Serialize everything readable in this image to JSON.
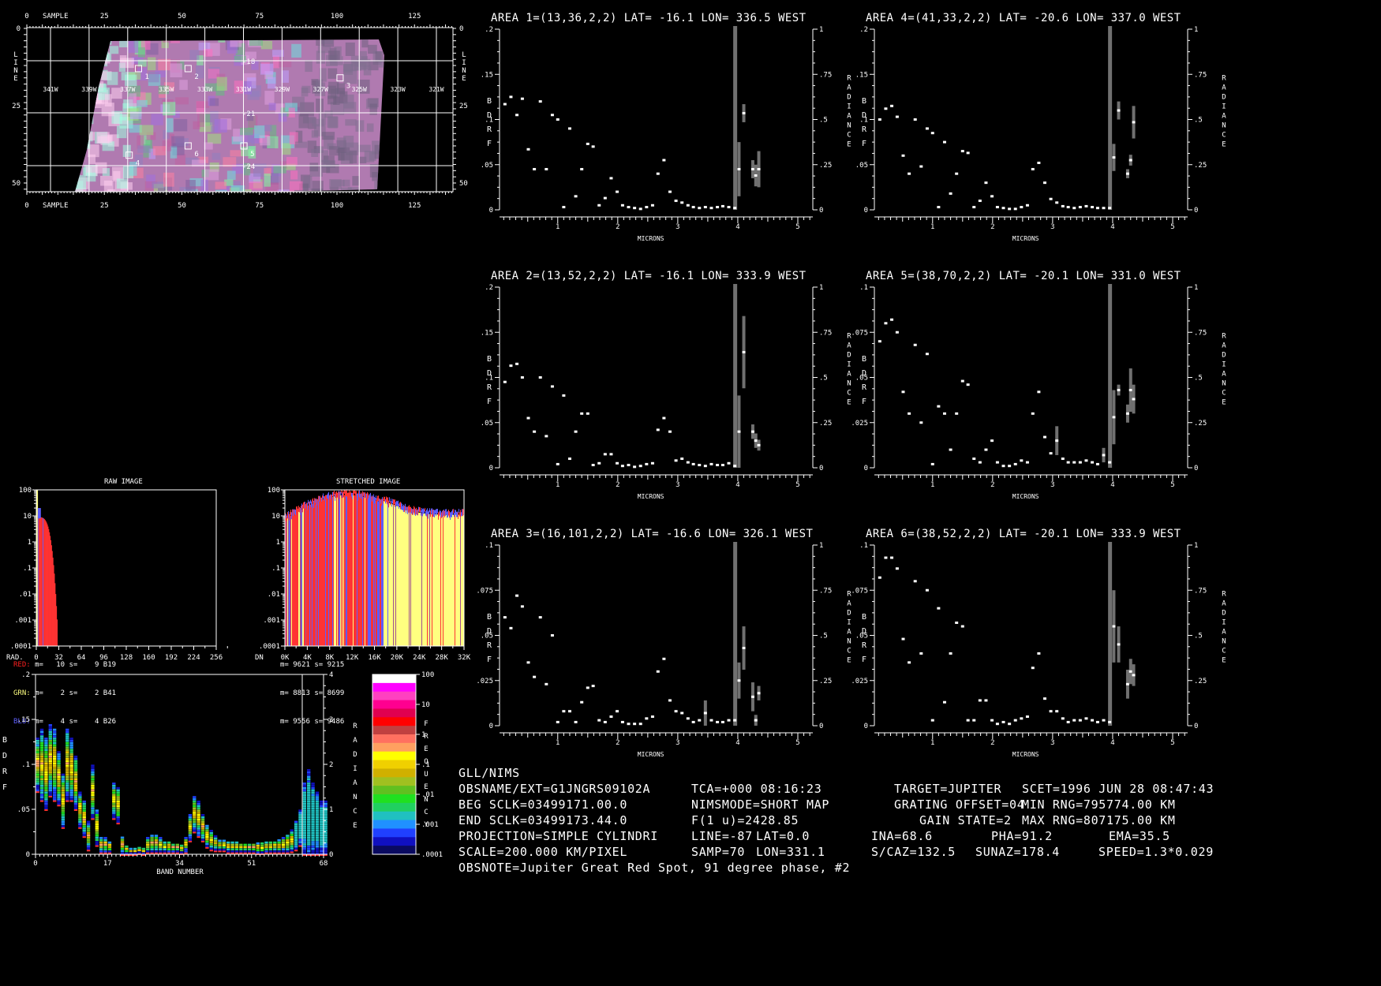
{
  "map": {
    "sample_label": "SAMPLE",
    "line_label": "LINE",
    "sample_ticks": [
      "0",
      "25",
      "50",
      "75",
      "100",
      "125"
    ],
    "line_ticks": [
      "0",
      "25",
      "50"
    ],
    "lon_labels": [
      "341W",
      "339W",
      "337W",
      "335W",
      "333W",
      "331W",
      "329W",
      "327W",
      "325W",
      "323W",
      "321W"
    ],
    "lat_labels": [
      "-18",
      "-21",
      "-24"
    ],
    "areas": [
      {
        "id": "1",
        "line": 13,
        "sample": 36
      },
      {
        "id": "2",
        "line": 13,
        "sample": 52
      },
      {
        "id": "3",
        "line": 16,
        "sample": 101
      },
      {
        "id": "4",
        "line": 41,
        "sample": 33
      },
      {
        "id": "5",
        "line": 38,
        "sample": 70
      },
      {
        "id": "6",
        "line": 38,
        "sample": 52
      }
    ]
  },
  "raw_hist": {
    "title": "RAW IMAGE",
    "x_label": "RAD.",
    "x_ticks": [
      "0",
      "32",
      "64",
      "96",
      "128",
      "160",
      "192",
      "224",
      "256"
    ],
    "y_ticks": [
      "100",
      "10",
      "1",
      ".1",
      ".01",
      ".001",
      ".0001"
    ],
    "stats": [
      {
        "label": "RED:",
        "text": "m=   10 s=    9 B19",
        "color": "#ff2020"
      },
      {
        "label": "GRN:",
        "text": "m=    2 s=    2 B41",
        "color": "#ffff80"
      },
      {
        "label": "BLU:",
        "text": "m=    4 s=    4 B26",
        "color": "#6060ff"
      }
    ]
  },
  "stretched_hist": {
    "title": "STRETCHED IMAGE",
    "x_label": "DN",
    "x_ticks": [
      "0K",
      "4K",
      "8K",
      "12K",
      "16K",
      "20K",
      "24K",
      "28K",
      "32K"
    ],
    "y_ticks": [
      "100",
      "10",
      "1",
      ".1",
      ".01",
      ".001",
      ".0001"
    ],
    "stats": [
      "m= 9621 s= 9215",
      "m= 8813 s= 8699",
      "m= 9556 s= 9486"
    ]
  },
  "colors": {
    "red": "#ff3333",
    "yellow": "#ffff80",
    "blue": "#5c5cff",
    "bar": "#707070"
  },
  "band_plot": {
    "x_label": "BAND NUMBER",
    "x_ticks": [
      "0",
      "17",
      "34",
      "51",
      "68"
    ],
    "y_ticks": [
      ".2",
      ".15",
      ".1",
      ".05",
      "0"
    ],
    "right_ticks": [
      "4",
      "3",
      "2",
      "1",
      "0"
    ],
    "left_label": "BDRF",
    "right_label": "RADIANCE",
    "freq_label": "FREQUENCY",
    "freq_ticks": [
      "100",
      "10",
      "1",
      ".1",
      ".01",
      ".001",
      ".0001"
    ],
    "center": [
      0.1,
      0.1,
      0.09,
      0.105,
      0.1,
      0.085,
      0.06,
      0.1,
      0.095,
      0.08,
      0.05,
      0.04,
      0.02,
      0.07,
      0.03,
      0.01,
      0.01,
      0.008,
      0.06,
      0.055,
      0.01,
      0.005,
      0.003,
      0.003,
      0.004,
      0.003,
      0.01,
      0.012,
      0.012,
      0.01,
      0.008,
      0.008,
      0.007,
      0.007,
      0.006,
      0.01,
      0.03,
      0.045,
      0.04,
      0.03,
      0.02,
      0.015,
      0.012,
      0.01,
      0.01,
      0.008,
      0.008,
      0.008,
      0.007,
      0.007,
      0.007,
      0.007,
      0.007,
      0.007,
      0.008,
      0.008,
      0.008,
      0.009,
      0.01,
      0.012,
      0.015,
      0.02,
      0.03,
      0.04,
      0.045,
      0.04,
      0.035,
      0.03,
      0.03
    ],
    "spread": [
      0.03,
      0.04,
      0.04,
      0.04,
      0.04,
      0.03,
      0.03,
      0.04,
      0.035,
      0.03,
      0.02,
      0.02,
      0.015,
      0.03,
      0.02,
      0.008,
      0.008,
      0.006,
      0.02,
      0.02,
      0.01,
      0.005,
      0.003,
      0.003,
      0.003,
      0.003,
      0.008,
      0.01,
      0.01,
      0.008,
      0.006,
      0.006,
      0.005,
      0.005,
      0.005,
      0.008,
      0.015,
      0.02,
      0.02,
      0.015,
      0.012,
      0.01,
      0.008,
      0.006,
      0.006,
      0.006,
      0.006,
      0.006,
      0.005,
      0.005,
      0.005,
      0.005,
      0.006,
      0.006,
      0.006,
      0.006,
      0.006,
      0.007,
      0.008,
      0.01,
      0.012,
      0.015,
      0.02,
      0.04,
      0.05,
      0.04,
      0.035,
      0.03,
      0.03
    ]
  },
  "chart_data": [
    {
      "type": "scatter",
      "title": "AREA 1=(13,36,2,2) LAT= -16.1 LON= 336.5 WEST",
      "xlabel": "MICRONS",
      "ylabel": "BDRF",
      "y2label": "RADIANCE",
      "xlim": [
        0.03,
        5.25
      ],
      "ylim": [
        0,
        0.2
      ],
      "y_ticks": [
        "0",
        ".05",
        ".1",
        ".15",
        ".2"
      ],
      "y2_ticks": [
        "0",
        ".25",
        ".5",
        ".75",
        "1"
      ],
      "x_ticks": [
        "1",
        "2",
        "3",
        "4",
        "5"
      ],
      "x": [
        0.12,
        0.22,
        0.32,
        0.41,
        0.51,
        0.61,
        0.71,
        0.81,
        0.91,
        1.0,
        1.1,
        1.2,
        1.3,
        1.4,
        1.5,
        1.59,
        1.69,
        1.79,
        1.89,
        1.99,
        2.08,
        2.18,
        2.28,
        2.38,
        2.48,
        2.58,
        2.67,
        2.77,
        2.87,
        2.97,
        3.07,
        3.17,
        3.26,
        3.36,
        3.46,
        3.56,
        3.66,
        3.75,
        3.85,
        3.95,
        4.02,
        4.1,
        4.25,
        4.3,
        4.35
      ],
      "y": [
        0.117,
        0.125,
        0.105,
        0.123,
        0.067,
        0.045,
        0.12,
        0.045,
        0.105,
        0.1,
        0.003,
        0.09,
        0.015,
        0.045,
        0.073,
        0.07,
        0.005,
        0.013,
        0.035,
        0.02,
        0.005,
        0.003,
        0.002,
        0.001,
        0.003,
        0.005,
        0.04,
        0.055,
        0.02,
        0.01,
        0.008,
        0.005,
        0.003,
        0.002,
        0.003,
        0.002,
        0.003,
        0.004,
        0.003,
        0.002,
        0.045,
        0.107,
        0.045,
        0.038,
        0.045
      ],
      "err": [
        0,
        0,
        0,
        0,
        0,
        0,
        0,
        0,
        0,
        0,
        0,
        0,
        0,
        0,
        0,
        0,
        0,
        0,
        0,
        0,
        0,
        0,
        0,
        0,
        0,
        0,
        0,
        0,
        0,
        0,
        0,
        0,
        0,
        0,
        0,
        0,
        0,
        0,
        0,
        0,
        0.03,
        0.01,
        0.01,
        0.012,
        0.02
      ]
    },
    {
      "type": "scatter",
      "title": "AREA 2=(13,52,2,2) LAT= -16.1 LON= 333.9 WEST",
      "xlabel": "MICRONS",
      "ylabel": "BDRF",
      "y2label": "RADIANCE",
      "xlim": [
        0.03,
        5.25
      ],
      "ylim": [
        0,
        0.2
      ],
      "y_ticks": [
        "0",
        ".05",
        ".1",
        ".15",
        ".2"
      ],
      "y2_ticks": [
        "0",
        ".25",
        ".5",
        ".75",
        "1"
      ],
      "x_ticks": [
        "1",
        "2",
        "3",
        "4",
        "5"
      ],
      "x": [
        0.12,
        0.22,
        0.32,
        0.41,
        0.51,
        0.61,
        0.71,
        0.81,
        0.91,
        1.0,
        1.1,
        1.2,
        1.3,
        1.4,
        1.5,
        1.59,
        1.69,
        1.79,
        1.89,
        1.99,
        2.08,
        2.18,
        2.28,
        2.38,
        2.48,
        2.58,
        2.67,
        2.77,
        2.87,
        2.97,
        3.07,
        3.17,
        3.26,
        3.36,
        3.46,
        3.56,
        3.66,
        3.75,
        3.85,
        3.95,
        4.02,
        4.1,
        4.25,
        4.3,
        4.35
      ],
      "y": [
        0.095,
        0.113,
        0.115,
        0.1,
        0.055,
        0.04,
        0.1,
        0.035,
        0.09,
        0.004,
        0.08,
        0.01,
        0.04,
        0.06,
        0.06,
        0.003,
        0.005,
        0.015,
        0.015,
        0.005,
        0.002,
        0.003,
        0.001,
        0.002,
        0.004,
        0.005,
        0.042,
        0.055,
        0.04,
        0.008,
        0.01,
        0.006,
        0.004,
        0.003,
        0.002,
        0.004,
        0.003,
        0.003,
        0.005,
        0.002,
        0.04,
        0.128,
        0.04,
        0.03,
        0.025
      ],
      "err": [
        0,
        0,
        0,
        0,
        0,
        0,
        0,
        0,
        0,
        0,
        0,
        0,
        0,
        0,
        0,
        0,
        0,
        0,
        0,
        0,
        0,
        0,
        0,
        0,
        0,
        0,
        0,
        0,
        0,
        0,
        0,
        0,
        0,
        0,
        0,
        0,
        0,
        0,
        0,
        0,
        0.04,
        0.04,
        0.008,
        0.008,
        0.006
      ]
    },
    {
      "type": "scatter",
      "title": "AREA 3=(16,101,2,2) LAT= -16.6 LON= 326.1 WEST",
      "xlabel": "MICRONS",
      "ylabel": "BDRF",
      "y2label": "RADIANCE",
      "xlim": [
        0.03,
        5.25
      ],
      "ylim": [
        0,
        0.1
      ],
      "y_ticks": [
        "0",
        ".025",
        ".05",
        ".075",
        ".1"
      ],
      "y2_ticks": [
        "0",
        ".25",
        ".5",
        ".75",
        "1"
      ],
      "x_ticks": [
        "1",
        "2",
        "3",
        "4",
        "5"
      ],
      "x": [
        0.12,
        0.22,
        0.32,
        0.41,
        0.51,
        0.61,
        0.71,
        0.81,
        0.91,
        1.0,
        1.1,
        1.2,
        1.3,
        1.4,
        1.5,
        1.59,
        1.69,
        1.79,
        1.89,
        1.99,
        2.08,
        2.18,
        2.28,
        2.38,
        2.48,
        2.58,
        2.67,
        2.77,
        2.87,
        2.97,
        3.07,
        3.17,
        3.26,
        3.36,
        3.46,
        3.56,
        3.66,
        3.75,
        3.85,
        3.95,
        4.02,
        4.1,
        4.25,
        4.3,
        4.35
      ],
      "y": [
        0.06,
        0.054,
        0.072,
        0.066,
        0.035,
        0.027,
        0.06,
        0.023,
        0.05,
        0.002,
        0.008,
        0.008,
        0.002,
        0.013,
        0.021,
        0.022,
        0.003,
        0.002,
        0.005,
        0.008,
        0.002,
        0.001,
        0.001,
        0.001,
        0.004,
        0.005,
        0.03,
        0.037,
        0.014,
        0.008,
        0.007,
        0.004,
        0.002,
        0.003,
        0.007,
        0.003,
        0.002,
        0.002,
        0.003,
        0.003,
        0.025,
        0.043,
        0.016,
        0.003,
        0.018
      ],
      "err": [
        0,
        0,
        0,
        0,
        0,
        0,
        0,
        0,
        0,
        0,
        0,
        0,
        0,
        0,
        0,
        0,
        0,
        0,
        0,
        0,
        0,
        0,
        0,
        0,
        0,
        0,
        0,
        0,
        0,
        0,
        0,
        0,
        0,
        0,
        0.007,
        0,
        0,
        0,
        0,
        0,
        0.01,
        0.012,
        0.008,
        0.003,
        0.004
      ]
    },
    {
      "type": "scatter",
      "title": "AREA 4=(41,33,2,2) LAT= -20.6 LON= 337.0 WEST",
      "xlabel": "MICRONS",
      "ylabel": "BDRF",
      "y2label": "RADIANCE",
      "xlim": [
        0.03,
        5.25
      ],
      "ylim": [
        0,
        0.2
      ],
      "y_ticks": [
        "0",
        ".05",
        ".1",
        ".15",
        ".2"
      ],
      "y2_ticks": [
        "0",
        ".25",
        ".5",
        ".75",
        "1"
      ],
      "x_ticks": [
        "1",
        "2",
        "3",
        "4",
        "5"
      ],
      "x": [
        0.12,
        0.22,
        0.32,
        0.41,
        0.51,
        0.61,
        0.71,
        0.81,
        0.91,
        1.0,
        1.1,
        1.2,
        1.3,
        1.4,
        1.5,
        1.59,
        1.69,
        1.79,
        1.89,
        1.99,
        2.08,
        2.18,
        2.28,
        2.38,
        2.48,
        2.58,
        2.67,
        2.77,
        2.87,
        2.97,
        3.07,
        3.17,
        3.26,
        3.36,
        3.46,
        3.56,
        3.66,
        3.75,
        3.85,
        3.95,
        4.02,
        4.1,
        4.25,
        4.3,
        4.35
      ],
      "y": [
        0.1,
        0.112,
        0.115,
        0.103,
        0.06,
        0.04,
        0.1,
        0.048,
        0.09,
        0.085,
        0.003,
        0.075,
        0.018,
        0.04,
        0.065,
        0.063,
        0.003,
        0.01,
        0.03,
        0.015,
        0.003,
        0.002,
        0.001,
        0.001,
        0.003,
        0.005,
        0.045,
        0.052,
        0.03,
        0.012,
        0.008,
        0.004,
        0.003,
        0.002,
        0.003,
        0.004,
        0.003,
        0.002,
        0.002,
        0.002,
        0.058,
        0.11,
        0.04,
        0.055,
        0.097
      ],
      "err": [
        0,
        0,
        0,
        0,
        0,
        0,
        0,
        0,
        0,
        0,
        0,
        0,
        0,
        0,
        0,
        0,
        0,
        0,
        0,
        0,
        0,
        0,
        0,
        0,
        0,
        0,
        0,
        0,
        0,
        0,
        0,
        0,
        0,
        0,
        0,
        0,
        0,
        0,
        0,
        0,
        0.015,
        0.01,
        0.005,
        0.006,
        0.018
      ]
    },
    {
      "type": "scatter",
      "title": "AREA 5=(38,70,2,2) LAT= -20.1 LON= 331.0 WEST",
      "xlabel": "MICRONS",
      "ylabel": "BDRF",
      "y2label": "RADIANCE",
      "xlim": [
        0.03,
        5.25
      ],
      "ylim": [
        0,
        0.1
      ],
      "y_ticks": [
        "0",
        ".025",
        ".05",
        ".075",
        ".1"
      ],
      "y2_ticks": [
        "0",
        ".25",
        ".5",
        ".75",
        "1"
      ],
      "x_ticks": [
        "1",
        "2",
        "3",
        "4",
        "5"
      ],
      "x": [
        0.12,
        0.22,
        0.32,
        0.41,
        0.51,
        0.61,
        0.71,
        0.81,
        0.91,
        1.0,
        1.1,
        1.2,
        1.3,
        1.4,
        1.5,
        1.59,
        1.69,
        1.79,
        1.89,
        1.99,
        2.08,
        2.18,
        2.28,
        2.38,
        2.48,
        2.58,
        2.67,
        2.77,
        2.87,
        2.97,
        3.07,
        3.17,
        3.26,
        3.36,
        3.46,
        3.56,
        3.66,
        3.75,
        3.85,
        3.95,
        4.02,
        4.1,
        4.25,
        4.3,
        4.35
      ],
      "y": [
        0.07,
        0.08,
        0.082,
        0.075,
        0.042,
        0.03,
        0.068,
        0.025,
        0.063,
        0.002,
        0.034,
        0.03,
        0.01,
        0.03,
        0.048,
        0.046,
        0.005,
        0.003,
        0.01,
        0.015,
        0.003,
        0.001,
        0.001,
        0.002,
        0.004,
        0.003,
        0.03,
        0.042,
        0.017,
        0.008,
        0.015,
        0.005,
        0.003,
        0.003,
        0.003,
        0.004,
        0.003,
        0.002,
        0.007,
        0.003,
        0.028,
        0.043,
        0.03,
        0.043,
        0.038
      ],
      "err": [
        0,
        0,
        0,
        0,
        0,
        0,
        0,
        0,
        0,
        0,
        0,
        0,
        0,
        0,
        0,
        0,
        0,
        0,
        0,
        0,
        0,
        0,
        0,
        0,
        0,
        0,
        0,
        0,
        0,
        0,
        0.008,
        0,
        0,
        0,
        0,
        0,
        0,
        0,
        0.004,
        0,
        0.015,
        0.003,
        0.005,
        0.012,
        0.008
      ]
    },
    {
      "type": "scatter",
      "title": "AREA 6=(38,52,2,2) LAT= -20.1 LON= 333.9 WEST",
      "xlabel": "MICRONS",
      "ylabel": "BDRF",
      "y2label": "RADIANCE",
      "xlim": [
        0.03,
        5.25
      ],
      "ylim": [
        0,
        0.1
      ],
      "y_ticks": [
        "0",
        ".025",
        ".05",
        ".075",
        ".1"
      ],
      "y2_ticks": [
        "0",
        ".25",
        ".5",
        ".75",
        "1"
      ],
      "x_ticks": [
        "1",
        "2",
        "3",
        "4",
        "5"
      ],
      "x": [
        0.12,
        0.22,
        0.32,
        0.41,
        0.51,
        0.61,
        0.71,
        0.81,
        0.91,
        1.0,
        1.1,
        1.2,
        1.3,
        1.4,
        1.5,
        1.59,
        1.69,
        1.79,
        1.89,
        1.99,
        2.08,
        2.18,
        2.28,
        2.38,
        2.48,
        2.58,
        2.67,
        2.77,
        2.87,
        2.97,
        3.07,
        3.17,
        3.26,
        3.36,
        3.46,
        3.56,
        3.66,
        3.75,
        3.85,
        3.95,
        4.02,
        4.1,
        4.25,
        4.3,
        4.35
      ],
      "y": [
        0.082,
        0.093,
        0.093,
        0.087,
        0.048,
        0.035,
        0.08,
        0.04,
        0.075,
        0.003,
        0.065,
        0.013,
        0.04,
        0.057,
        0.055,
        0.003,
        0.003,
        0.014,
        0.014,
        0.003,
        0.001,
        0.002,
        0.001,
        0.003,
        0.004,
        0.005,
        0.032,
        0.04,
        0.015,
        0.008,
        0.008,
        0.004,
        0.002,
        0.003,
        0.003,
        0.004,
        0.003,
        0.002,
        0.003,
        0.002,
        0.055,
        0.045,
        0.023,
        0.03,
        0.028
      ],
      "err": [
        0,
        0,
        0,
        0,
        0,
        0,
        0,
        0,
        0,
        0,
        0,
        0,
        0,
        0,
        0,
        0,
        0,
        0,
        0,
        0,
        0,
        0,
        0,
        0,
        0,
        0,
        0,
        0,
        0,
        0,
        0,
        0,
        0,
        0,
        0,
        0,
        0,
        0,
        0,
        0,
        0.02,
        0.01,
        0.008,
        0.007,
        0.006
      ]
    }
  ],
  "info": {
    "instrument": "GLL/NIMS",
    "obsname": "OBSNAME/EXT=G1JNGRS09102A",
    "tca": "TCA=+000 08:16:23",
    "target": "TARGET=JUPITER",
    "scet": "SCET=1996 JUN 28 08:47:43",
    "beg_sclk": "BEG SCLK=03499171.00.0",
    "nimsmode": "NIMSMODE=SHORT MAP",
    "grating": "GRATING OFFSET=04",
    "min_rng": "MIN RNG=795774.00 KM",
    "end_sclk": "END SCLK=03499173.44.0",
    "f1u": "F(1 u)=2428.85",
    "gain": "GAIN STATE=2",
    "max_rng": "MAX RNG=807175.00 KM",
    "projection": "PROJECTION=SIMPLE CYLINDRI",
    "line": "LINE=-87",
    "lat": "LAT=0.0",
    "ina": "INA=68.6",
    "pha": "PHA=91.2",
    "ema": "EMA=35.5",
    "scale": "SCALE=200.000 KM/PIXEL",
    "samp": "SAMP=70",
    "lon": "LON=331.1",
    "scaz": "S/CAZ=132.5",
    "sunaz": "SUNAZ=178.4",
    "speed": "SPEED=1.3*0.029",
    "obsnote": "OBSNOTE=Jupiter Great Red Spot, 91 degree phase, #2"
  }
}
